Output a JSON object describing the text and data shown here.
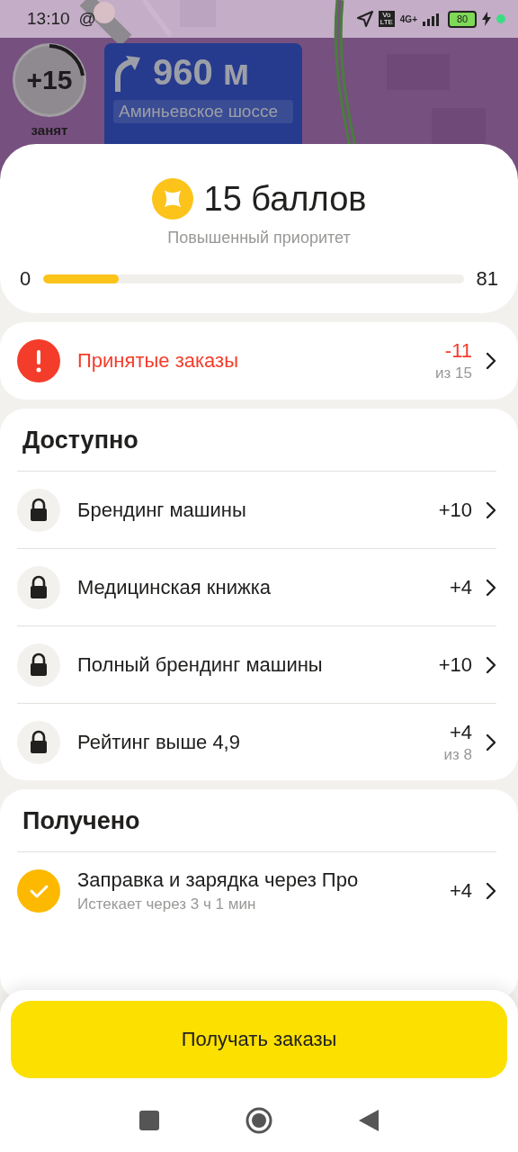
{
  "status_bar": {
    "time": "13:10",
    "at_sign": "@",
    "network": "4G+",
    "volte": "Vo LTE",
    "battery": "80"
  },
  "map_overlay": {
    "points_badge": "+15",
    "driver_status": "занят",
    "maneuver_distance": "960 м",
    "maneuver_street": "Аминьевское шоссе"
  },
  "score": {
    "title": "15 баллов",
    "subtitle": "Повышенный приоритет",
    "min": "0",
    "max": "81",
    "level": 0.18
  },
  "alert": {
    "kind": "error",
    "label": "Принятые заказы",
    "value": "-11",
    "note": "из 15"
  },
  "sections": [
    {
      "title": "Доступно",
      "items": [
        {
          "kind": "locked",
          "label": "Брендинг машины",
          "value": "+10"
        },
        {
          "kind": "locked",
          "label": "Медицинская книжка",
          "value": "+4"
        },
        {
          "kind": "locked",
          "label": "Полный брендинг машины",
          "value": "+10"
        },
        {
          "kind": "locked",
          "label": "Рейтинг выше 4,9",
          "value": "+4",
          "note": "из 8"
        }
      ]
    },
    {
      "title": "Получено",
      "items": [
        {
          "kind": "done",
          "label": "Заправка и зарядка через Про",
          "sublabel": "Истекает через 3 ч 1 мин",
          "value": "+4"
        }
      ]
    }
  ],
  "primary_button": "Получать заказы"
}
